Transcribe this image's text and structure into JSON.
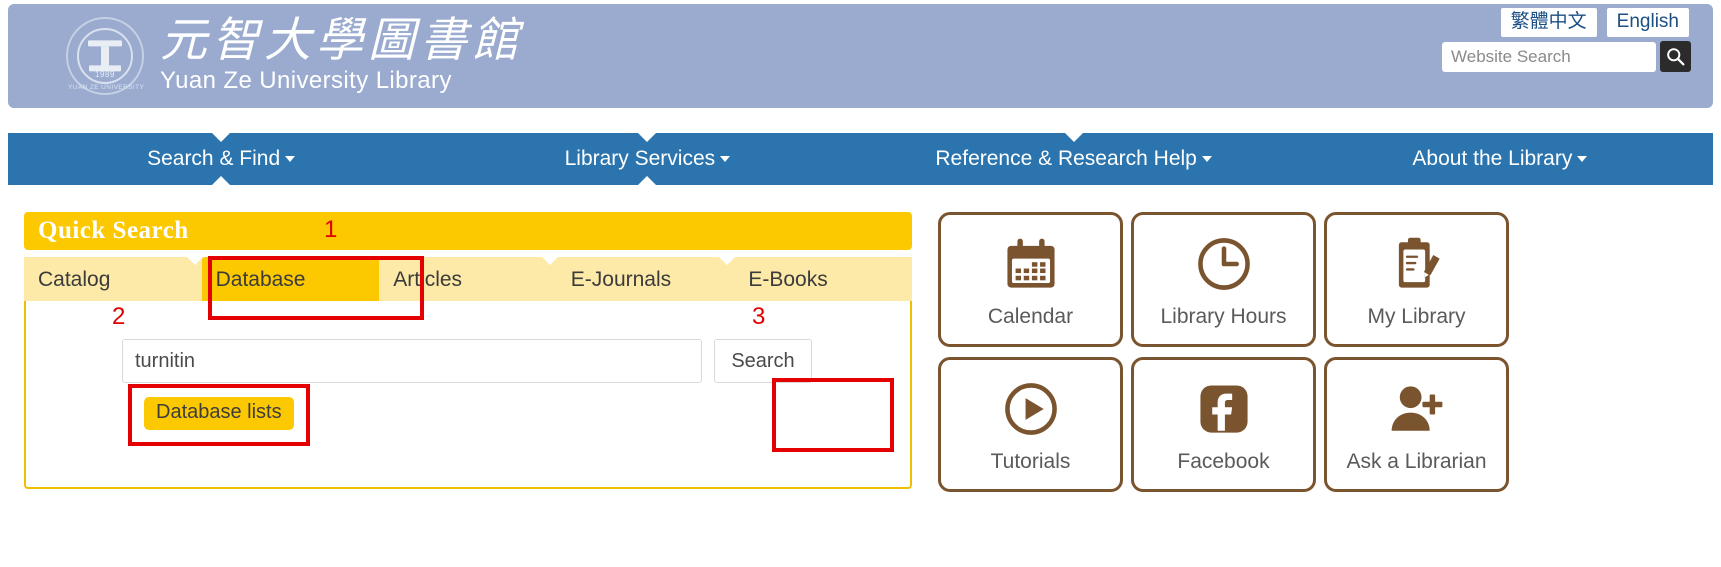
{
  "header": {
    "title_cn": "元智大學圖書館",
    "title_en": "Yuan Ze University Library",
    "seal_year": "1989",
    "seal_ring": "YUAN ZE UNIVERSITY",
    "lang_cn": "繁體中文",
    "lang_en": "English",
    "site_search_placeholder": "Website Search",
    "site_search_value": "",
    "search_icon": "magnifier-icon",
    "bg_color": "#9aabcf"
  },
  "nav": {
    "accent": "#2b74ae",
    "items": [
      {
        "label": "Search & Find"
      },
      {
        "label": "Library Services"
      },
      {
        "label": "Reference & Research Help"
      },
      {
        "label": "About the Library"
      }
    ]
  },
  "quick_search": {
    "title": "Quick Search",
    "accent": "#fcc800",
    "tabs": [
      {
        "label": "Catalog",
        "active": false
      },
      {
        "label": "Database",
        "active": true
      },
      {
        "label": "Articles",
        "active": false
      },
      {
        "label": "E-Journals",
        "active": false
      },
      {
        "label": "E-Books",
        "active": false
      }
    ],
    "input_value": "turnitin",
    "input_placeholder": "",
    "search_button": "Search",
    "database_lists_button": "Database lists"
  },
  "annotations": {
    "color": "#e40000",
    "markers": [
      {
        "id": "1",
        "target": "quick-search-title"
      },
      {
        "id": "2",
        "target": "search-input"
      },
      {
        "id": "3",
        "target": "search-button"
      }
    ]
  },
  "tiles": [
    {
      "label": "Calendar",
      "icon": "calendar-icon"
    },
    {
      "label": "Library Hours",
      "icon": "clock-icon"
    },
    {
      "label": "My Library",
      "icon": "clipboard-pencil-icon"
    },
    {
      "label": "Tutorials",
      "icon": "play-circle-icon"
    },
    {
      "label": "Facebook",
      "icon": "facebook-icon"
    },
    {
      "label": "Ask a Librarian",
      "icon": "user-plus-icon"
    }
  ],
  "tile_color": "#7a542f"
}
